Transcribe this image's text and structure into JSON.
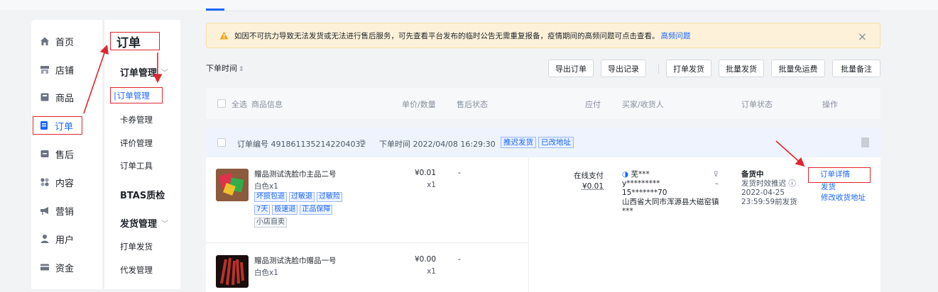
{
  "nav": {
    "items": [
      {
        "label": "首页",
        "icon": "home-icon"
      },
      {
        "label": "店铺",
        "icon": "store-icon"
      },
      {
        "label": "商品",
        "icon": "product-icon"
      },
      {
        "label": "订单",
        "icon": "order-icon"
      },
      {
        "label": "售后",
        "icon": "aftersale-icon"
      },
      {
        "label": "内容",
        "icon": "content-icon"
      },
      {
        "label": "营销",
        "icon": "marketing-icon"
      },
      {
        "label": "用户",
        "icon": "user-icon"
      },
      {
        "label": "资金",
        "icon": "wallet-icon"
      }
    ]
  },
  "subnav": {
    "title": "订单",
    "group1": "订单管理",
    "items1": [
      "订单管理",
      "卡券管理",
      "评价管理",
      "订单工具"
    ],
    "group2": "BTAS质检",
    "group3": "发货管理",
    "items3": [
      "打单发货",
      "代发管理"
    ]
  },
  "notice": {
    "text": "如因不可抗力导致无法发货或无法进行售后服务，可先查看平台发布的临时公告无需重复报备，疫情期间的高频问题可点击查看。",
    "link": "高频问题",
    "close": "×"
  },
  "toolbar": {
    "sort_label": "下单时间",
    "buttons": [
      "导出订单",
      "导出记录",
      "打单发货",
      "批量发货",
      "批量免运费",
      "批量备注"
    ]
  },
  "table_header": {
    "select_all": "全选",
    "columns": [
      "商品信息",
      "单价/数量",
      "售后状态",
      "应付",
      "买家/收货人",
      "订单状态",
      "操作"
    ]
  },
  "order": {
    "number_label": "订单编号 4918611352142204032",
    "time_label": "下单时间 2022/04/08 16:29:30",
    "tags": [
      "推迟发货",
      "已改地址"
    ],
    "products": [
      {
        "title": "赠品测试洗脸巾主品二号",
        "sku": "白色x1",
        "tags": [
          "坏损包退",
          "过敏退",
          "过敏险",
          "7天",
          "极速退",
          "正品保障"
        ],
        "shop_tag": "小店自卖",
        "price": "¥0.01",
        "qty": "x1",
        "aftersale": "-"
      },
      {
        "title": "赠品测试洗脸巾赠品一号",
        "sku": "白色x1",
        "price": "¥0.00",
        "qty": "x1",
        "aftersale": "-"
      }
    ],
    "payment": {
      "method": "在线支付",
      "amount": "¥0.01"
    },
    "buyer": {
      "name": "芜***",
      "account": "y*********",
      "phone": "15*******70",
      "address": "山西省大同市浑源县大磁窑镇 ***"
    },
    "status": {
      "main": "备货中",
      "sub": "发货时效推迟",
      "date": "2022-04-25",
      "deadline": "23:59:59前发货"
    },
    "ops": [
      "订单详情",
      "发货",
      "修改收货地址"
    ]
  },
  "colors": {
    "accent": "#1966ff",
    "annotation": "#e0262d",
    "notice_bg": "#fdf2d9"
  }
}
